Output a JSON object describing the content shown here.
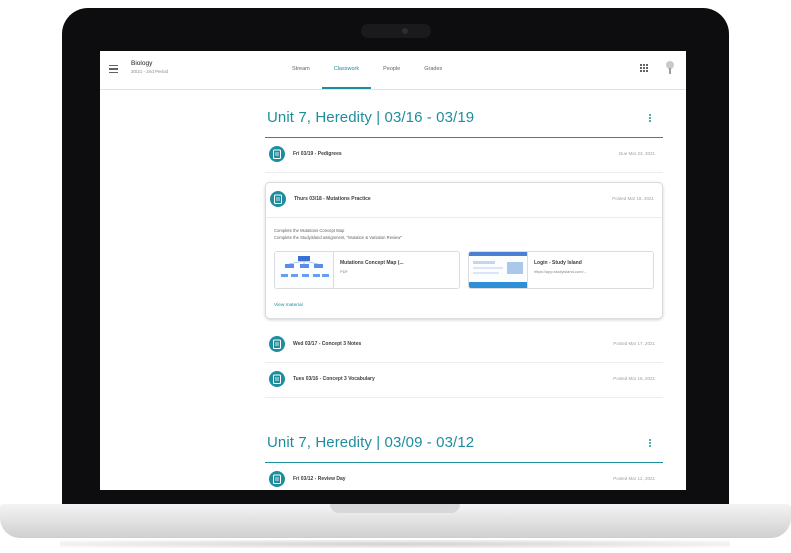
{
  "app": {
    "course_title": "Biology",
    "course_section": "20/21 - 2nd Period"
  },
  "tabs": [
    {
      "label": "Stream"
    },
    {
      "label": "Classwork"
    },
    {
      "label": "People"
    },
    {
      "label": "Grades"
    }
  ],
  "active_tab": "Classwork",
  "units": [
    {
      "title": "Unit 7, Heredity | 03/16 - 03/19",
      "items": [
        {
          "title": "Fri 03/19 - Pedigrees",
          "date": "Due Mar 23, 2021"
        }
      ],
      "expanded_item": {
        "title": "Thurs 03/18 - Mutations Practice",
        "date": "Posted Mar 18, 2021",
        "description_lines": [
          "Complete the Mutations Concept Map",
          "Complete the Studyisland assignment, \"Mutation & Variation Review\""
        ],
        "attachments": [
          {
            "title": "Mutations Concept Map (...",
            "subtitle": "PDF"
          },
          {
            "title": "Login - Study Island",
            "subtitle": "https://app.studyisland.com/..."
          }
        ],
        "view_link": "View material"
      },
      "items_after": [
        {
          "title": "Wed 03/17 - Concept 3 Notes",
          "date": "Posted Mar 17, 2021"
        },
        {
          "title": "Tues 03/16 - Concept 3 Vocabulary",
          "date": "Posted Mar 16, 2021"
        }
      ]
    },
    {
      "title": "Unit 7, Heredity | 03/09 - 03/12",
      "items": [
        {
          "title": "Fri 03/12 - Review Day",
          "date": "Posted Mar 12, 2021"
        }
      ]
    }
  ],
  "colors": {
    "accent": "#1e8e9e",
    "frame": "#0d0d0f"
  }
}
